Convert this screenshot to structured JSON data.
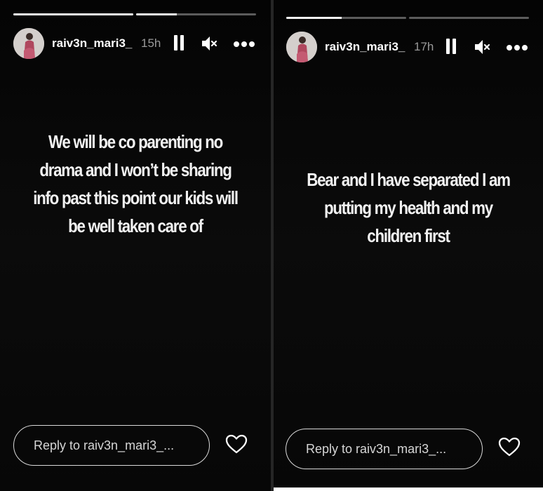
{
  "stories": [
    {
      "username": "raiv3n_mari3_",
      "time": "15h",
      "progress": [
        1.0,
        0.34
      ],
      "text_lines": [
        "We will be co parenting no",
        "drama and I won’t be sharing",
        "info past this point our kids will",
        "be well taken care of"
      ],
      "reply_placeholder": "Reply to raiv3n_mari3_..."
    },
    {
      "username": "raiv3n_mari3_",
      "time": "17h",
      "progress": [
        0.46,
        0.0
      ],
      "text_lines": [
        "Bear and I have separated I am",
        "putting my health and my",
        "children first"
      ],
      "reply_placeholder": "Reply to raiv3n_mari3_..."
    }
  ],
  "icons": {
    "pause": "pause-icon",
    "mute": "speaker-muted-icon",
    "more": "more-options-icon",
    "like": "heart-icon"
  },
  "colors": {
    "background": "#080808",
    "text": "#f2f2f2",
    "time": "#9a9a9a",
    "progress_track": "rgba(255,255,255,0.35)"
  }
}
